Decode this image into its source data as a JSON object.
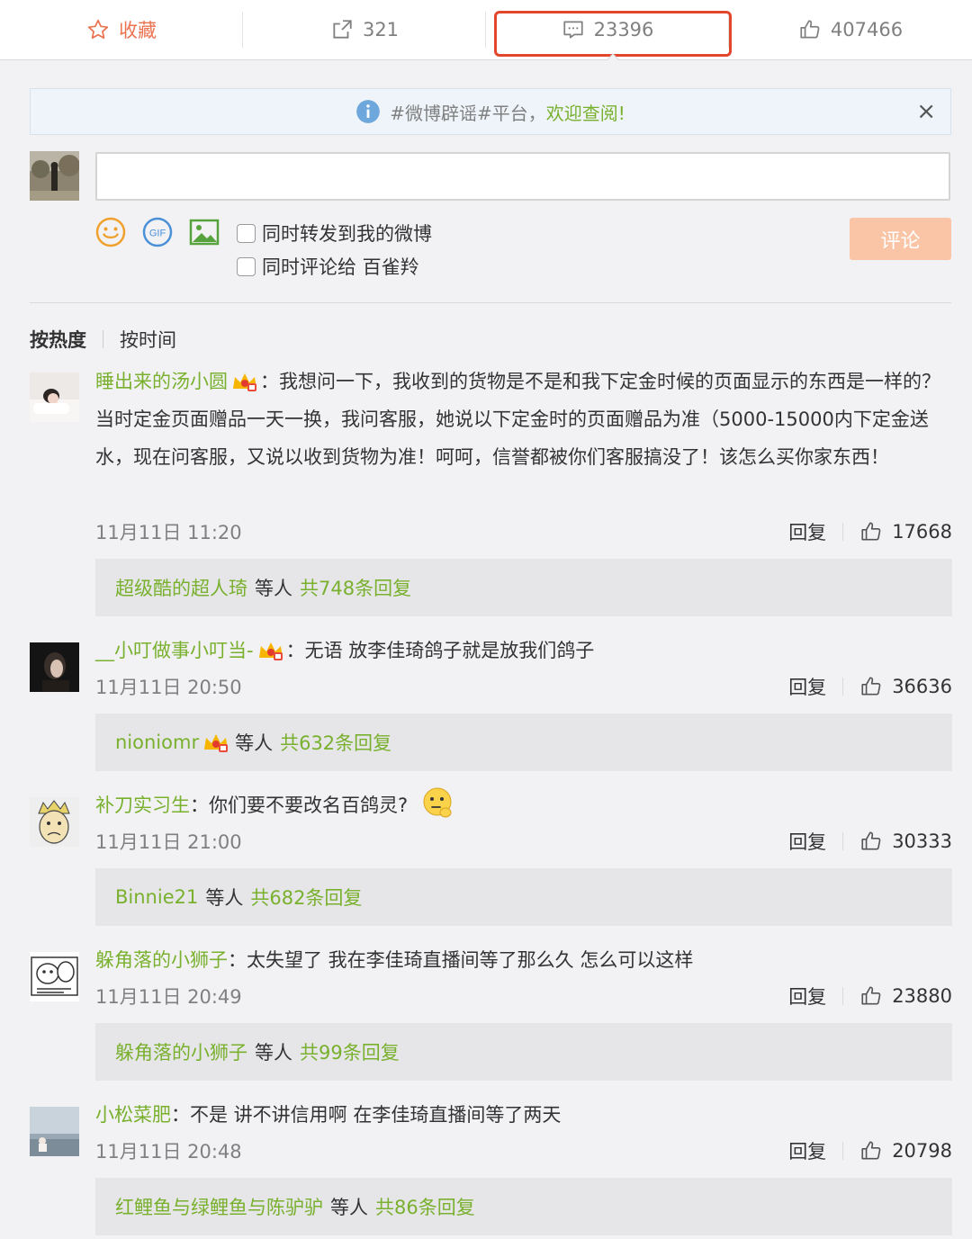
{
  "action_bar": {
    "favorite_label": "收藏",
    "repost_count": "321",
    "comment_count": "23396",
    "like_count": "407466",
    "highlight_color": "#e2462b"
  },
  "notice": {
    "text_gray": "#微博辟谣#平台，",
    "text_green": "欢迎查阅!",
    "close": "×"
  },
  "composer": {
    "icons": [
      "smiley-icon",
      "gif-icon",
      "image-icon"
    ],
    "gif_label": "GIF",
    "repost_option": "同时转发到我的微博",
    "comment_to_option": "同时评论给 百雀羚",
    "submit_label": "评论"
  },
  "sort": {
    "hot": "按热度",
    "time": "按时间"
  },
  "comments": [
    {
      "user": "睡出来的汤小圆",
      "sep": "：",
      "text": "我想问一下，我收到的货物是不是和我下定金时候的页面显示的东西是一样的？当时定金页面赠品一天一换，我问客服，她说以下定金时的页面赠品为准（5000-15000内下定金送水，现在问客服，又说以收到货物为准！呵呵，信誉都被你们客服搞没了！该怎么买你家东西！",
      "time": "11月11日 11:20",
      "reply": "回复",
      "likes": "17668",
      "reply_user": "超级酷的超人琦",
      "reply_mid": "等人",
      "reply_total": "共748条回复"
    },
    {
      "user": "__小叮做事小叮当-",
      "sep": "：",
      "text": "无语 放李佳琦鸽子就是放我们鸽子",
      "time": "11月11日 20:50",
      "reply": "回复",
      "likes": "36636",
      "reply_user": "nioniomr",
      "reply_mid": "等人",
      "reply_total": "共632条回复"
    },
    {
      "user": "补刀实习生",
      "sep": "：",
      "text": "你们要不要改名百鸽灵?",
      "time": "11月11日 21:00",
      "reply": "回复",
      "likes": "30333",
      "reply_user": "Binnie21",
      "reply_mid": "等人",
      "reply_total": "共682条回复"
    },
    {
      "user": "躲角落的小狮子",
      "sep": "：",
      "text": "太失望了 我在李佳琦直播间等了那么久 怎么可以这样",
      "time": "11月11日 20:49",
      "reply": "回复",
      "likes": "23880",
      "reply_user": "躲角落的小狮子",
      "reply_mid": "等人",
      "reply_total": "共99条回复"
    },
    {
      "user": "小松菜肥",
      "sep": "：",
      "text": "不是 讲不讲信用啊 在李佳琦直播间等了两天",
      "time": "11月11日 20:48",
      "reply": "回复",
      "likes": "20798",
      "reply_user": "红鲤鱼与绿鲤鱼与陈驴驴",
      "reply_mid": "等人",
      "reply_total": "共86条回复"
    }
  ]
}
